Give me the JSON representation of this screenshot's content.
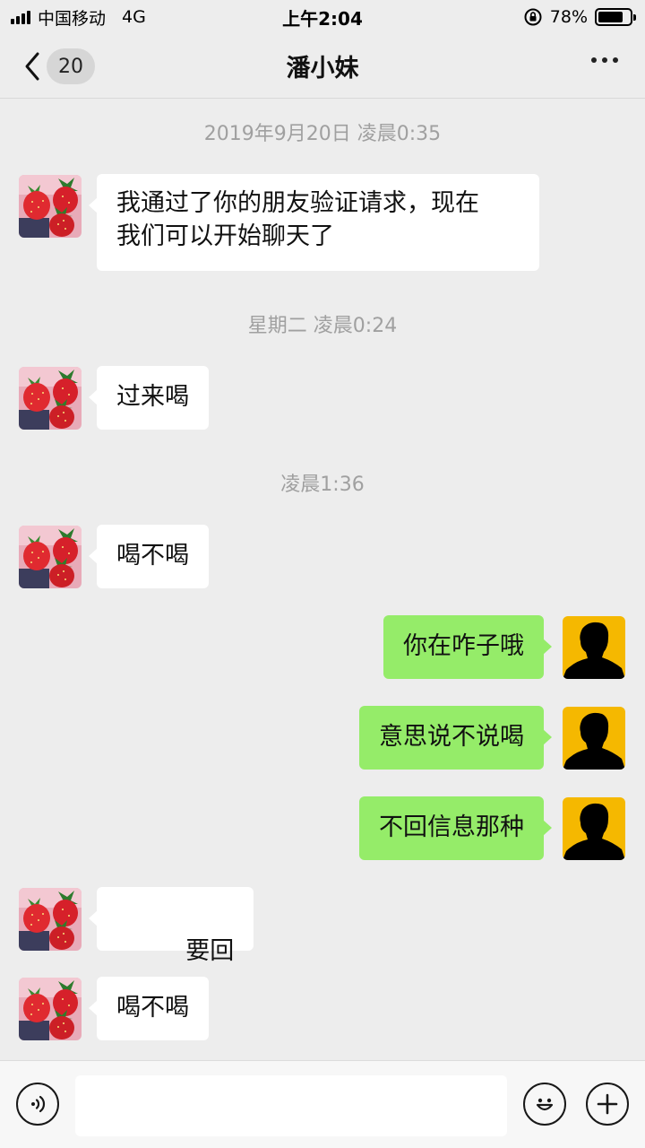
{
  "status_bar": {
    "carrier": "中国移动",
    "network": "4G",
    "time": "上午2:04",
    "battery": "78%",
    "battery_level": 0.78
  },
  "nav": {
    "unread_count": "20",
    "title": "潘小妹"
  },
  "messages": [
    {
      "type": "time",
      "text": "2019年9月20日 凌晨0:35"
    },
    {
      "type": "in",
      "avatar": "strawberry-avatar",
      "lines": [
        "我通过了你的朋友验证请求，现在",
        "我们可以开始聊天了"
      ]
    },
    {
      "type": "time",
      "text": "星期二 凌晨0:24"
    },
    {
      "type": "in",
      "avatar": "strawberry-avatar",
      "text": "过来喝"
    },
    {
      "type": "time",
      "text": "凌晨1:36"
    },
    {
      "type": "in",
      "avatar": "strawberry-avatar",
      "text": "喝不喝"
    },
    {
      "type": "out",
      "avatar": "silhouette-avatar",
      "text": "你在咋子哦"
    },
    {
      "type": "out",
      "avatar": "silhouette-avatar",
      "text": "意思说不说喝"
    },
    {
      "type": "out",
      "avatar": "silhouette-avatar",
      "text": "不回信息那种"
    },
    {
      "type": "in",
      "avatar": "strawberry-avatar",
      "text": " 要回"
    },
    {
      "type": "in",
      "avatar": "strawberry-avatar",
      "text": "喝不喝"
    }
  ],
  "input_bar": {
    "voice_icon": "voice-icon",
    "emoji_icon": "emoji-icon",
    "plus_icon": "plus-icon",
    "placeholder": ""
  },
  "colors": {
    "background": "#ededed",
    "outgoing_bubble": "#95ec69",
    "incoming_bubble": "#ffffff",
    "timestamp_text": "#a0a0a0",
    "my_avatar_bg": "#f5b800"
  }
}
